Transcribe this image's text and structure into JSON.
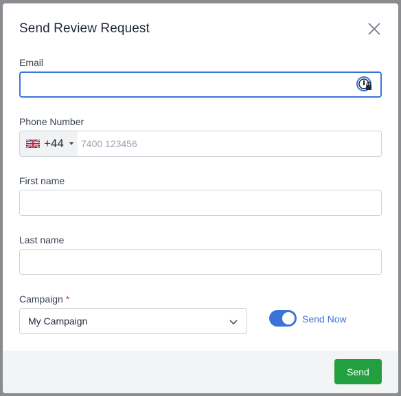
{
  "modal": {
    "title": "Send Review Request",
    "close_icon": "close-icon"
  },
  "email": {
    "label": "Email",
    "value": "",
    "placeholder": "",
    "password_manager_icon": "password-manager-icon"
  },
  "phone": {
    "label": "Phone Number",
    "country_flag": "uk-flag-icon",
    "dial_code": "+44",
    "value": "",
    "placeholder": "7400 123456"
  },
  "first_name": {
    "label": "First name",
    "value": ""
  },
  "last_name": {
    "label": "Last name",
    "value": ""
  },
  "campaign": {
    "label": "Campaign",
    "required_marker": "*",
    "selected": "My Campaign",
    "chevron_icon": "chevron-down-icon"
  },
  "send_now": {
    "label": "Send Now",
    "enabled": true
  },
  "footer": {
    "send_label": "Send"
  },
  "colors": {
    "accent": "#3b74d8",
    "send_button": "#22a040",
    "required": "#e0403c",
    "overlay": "#7d7f84"
  }
}
